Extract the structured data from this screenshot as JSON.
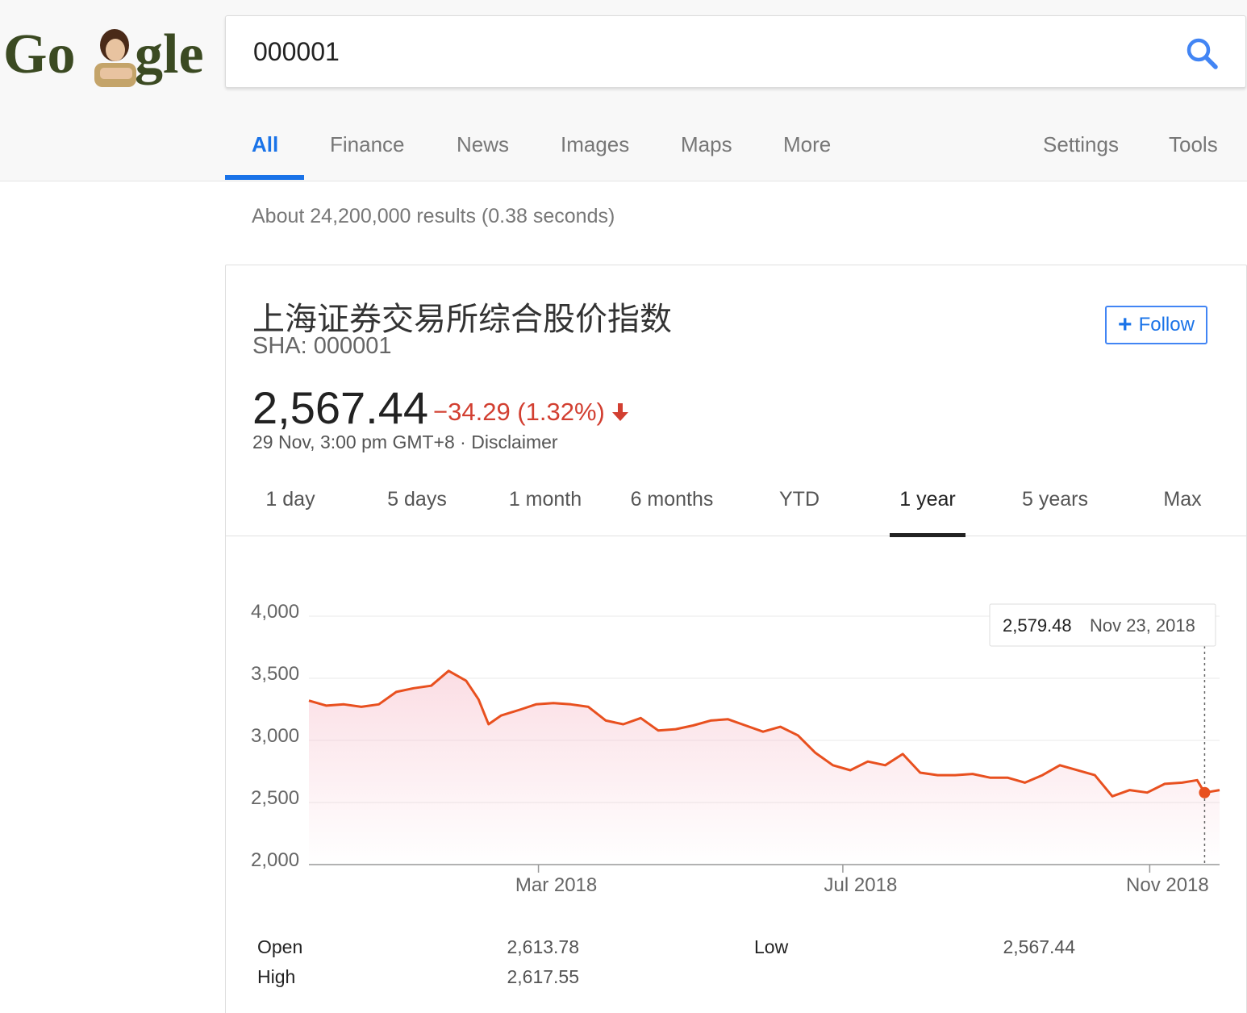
{
  "header": {
    "logo": {
      "icon": "google-doodle-logo",
      "text": "Google"
    },
    "search": {
      "query": "000001",
      "placeholder": ""
    },
    "search_icon": "magnifier-icon",
    "tabs": [
      {
        "label": "All",
        "active": true
      },
      {
        "label": "Finance"
      },
      {
        "label": "News"
      },
      {
        "label": "Images"
      },
      {
        "label": "Maps"
      },
      {
        "label": "More"
      },
      {
        "label": "Settings"
      },
      {
        "label": "Tools"
      }
    ],
    "accent_color": "#1a73e8"
  },
  "result_stats": "About 24,200,000 results (0.38 seconds)",
  "card": {
    "title": "上海证券交易所综合股价指数",
    "ticker": "SHA: 000001",
    "follow_label": "Follow",
    "price": "2,567.44",
    "change": "−34.29 (1.32%)",
    "change_color": "#d23f31",
    "timestamp": "29 Nov, 3:00 pm GMT+8",
    "separator": "·",
    "disclaimer": "Disclaimer",
    "ranges": [
      {
        "label": "1 day"
      },
      {
        "label": "5 days"
      },
      {
        "label": "1 month"
      },
      {
        "label": "6 months"
      },
      {
        "label": "YTD"
      },
      {
        "label": "1 year",
        "active": true
      },
      {
        "label": "5 years"
      },
      {
        "label": "Max"
      }
    ],
    "stats": [
      {
        "label": "Open",
        "value": "2,613.78"
      },
      {
        "label": "High",
        "value": "2,617.55"
      },
      {
        "label": "Low",
        "value": "2,567.44"
      }
    ]
  },
  "chart_data": {
    "type": "area",
    "ylim": [
      2000,
      4000
    ],
    "yticks": [
      {
        "value": 4000,
        "label": "4,000"
      },
      {
        "value": 3500,
        "label": "3,500"
      },
      {
        "value": 3000,
        "label": "3,000"
      },
      {
        "value": 2500,
        "label": "2,500"
      },
      {
        "value": 2000,
        "label": "2,000"
      }
    ],
    "xlim": [
      "2017-11-29",
      "2018-11-29"
    ],
    "xticks": [
      {
        "date": "2018-03-01",
        "label": "Mar 2018"
      },
      {
        "date": "2018-07-01",
        "label": "Jul 2018"
      },
      {
        "date": "2018-11-01",
        "label": "Nov 2018"
      }
    ],
    "line_color": "#e8501f",
    "fill_color": "#f8c7d2",
    "series": [
      {
        "x": [
          "2017-11-29",
          "2017-12-06",
          "2017-12-13",
          "2017-12-20",
          "2017-12-27",
          "2018-01-03",
          "2018-01-10",
          "2018-01-17",
          "2018-01-24",
          "2018-01-31",
          "2018-02-05",
          "2018-02-09",
          "2018-02-14",
          "2018-02-22",
          "2018-02-28",
          "2018-03-07",
          "2018-03-14",
          "2018-03-21",
          "2018-03-28",
          "2018-04-04",
          "2018-04-11",
          "2018-04-18",
          "2018-04-25",
          "2018-05-02",
          "2018-05-09",
          "2018-05-16",
          "2018-05-23",
          "2018-05-30",
          "2018-06-06",
          "2018-06-13",
          "2018-06-20",
          "2018-06-27",
          "2018-07-04",
          "2018-07-11",
          "2018-07-18",
          "2018-07-25",
          "2018-08-01",
          "2018-08-08",
          "2018-08-15",
          "2018-08-22",
          "2018-08-29",
          "2018-09-05",
          "2018-09-12",
          "2018-09-19",
          "2018-09-26",
          "2018-10-10",
          "2018-10-17",
          "2018-10-24",
          "2018-10-31",
          "2018-11-07",
          "2018-11-14",
          "2018-11-20",
          "2018-11-23",
          "2018-11-29"
        ],
        "y": [
          3320,
          3280,
          3290,
          3270,
          3290,
          3390,
          3420,
          3440,
          3560,
          3480,
          3330,
          3130,
          3200,
          3250,
          3290,
          3300,
          3290,
          3270,
          3160,
          3130,
          3180,
          3080,
          3090,
          3120,
          3160,
          3170,
          3120,
          3070,
          3110,
          3040,
          2900,
          2800,
          2760,
          2830,
          2800,
          2890,
          2740,
          2720,
          2720,
          2730,
          2700,
          2700,
          2660,
          2720,
          2800,
          2720,
          2550,
          2600,
          2580,
          2650,
          2660,
          2680,
          2579.48,
          2600
        ]
      }
    ],
    "tooltip": {
      "value": "2,579.48",
      "date": "Nov 23, 2018",
      "x": "2018-11-23",
      "y": 2579.48
    },
    "grid": true
  }
}
